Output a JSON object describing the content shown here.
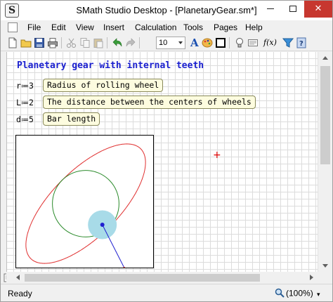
{
  "window": {
    "title": "SMath Studio Desktop - [PlanetaryGear.sm*]",
    "app_icon_glyph": "S",
    "close_glyph": "✕"
  },
  "menu": {
    "items": [
      "File",
      "Edit",
      "View",
      "Insert",
      "Calculation",
      "Tools",
      "Pages",
      "Help"
    ]
  },
  "toolbar": {
    "font_size": "10",
    "icons": [
      "new-document-icon",
      "open-folder-icon",
      "save-icon",
      "print-icon",
      "cut-icon",
      "copy-icon",
      "paste-icon",
      "undo-icon",
      "redo-icon",
      "font-size-select",
      "text-color-icon",
      "palette-icon",
      "border-icon",
      "bulb-icon",
      "format-selector-icon",
      "function-icon",
      "filter-icon",
      "help-icon"
    ],
    "function_label": "f(x)"
  },
  "worksheet": {
    "heading": "Planetary gear with internal teeth",
    "variables": [
      {
        "name": "r",
        "assign": "≔",
        "value": "3",
        "comment": "Radius of rolling wheel"
      },
      {
        "name": "L",
        "assign": "≔",
        "value": "2",
        "comment": "The distance between the centers of wheels"
      },
      {
        "name": "d",
        "assign": "≔",
        "value": "5",
        "comment": "Bar length"
      }
    ],
    "cursor_glyph": "+"
  },
  "plot": {
    "curve_color": "#e03030",
    "circle_color": "#2a8a2a",
    "disc_color": "#a8dbe8",
    "bar_color": "#2020d0"
  },
  "status": {
    "text": "Ready",
    "zoom": "(100%)"
  }
}
